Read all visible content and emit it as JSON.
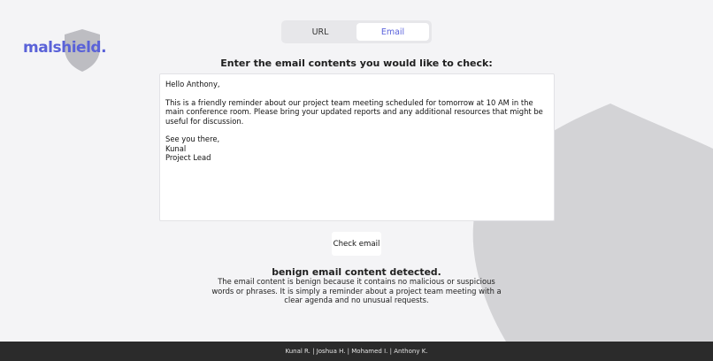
{
  "brand": {
    "logo_text": "malshield.",
    "accent_color": "#5a62d8",
    "shield_color": "#bdbdc2"
  },
  "tabs": [
    {
      "label": "URL",
      "active": false
    },
    {
      "label": "Email",
      "active": true
    }
  ],
  "main": {
    "prompt": "Enter the email contents you would like to check:",
    "email_text": "Hello Anthony,\n\nThis is a friendly reminder about our project team meeting scheduled for tomorrow at 10 AM in the main conference room. Please bring your updated reports and any additional resources that might be useful for discussion.\n\nSee you there,\nKunal\nProject Lead",
    "check_button_label": "Check email"
  },
  "result": {
    "title": "benign email content detected.",
    "explanation": "The email content is benign because it contains no malicious or suspicious words or phrases. It is simply a reminder about a project team meeting with a clear agenda and no unusual requests."
  },
  "footer": {
    "credits": "Kunal R. | Joshua H. | Mohamed I. | Anthony K."
  }
}
